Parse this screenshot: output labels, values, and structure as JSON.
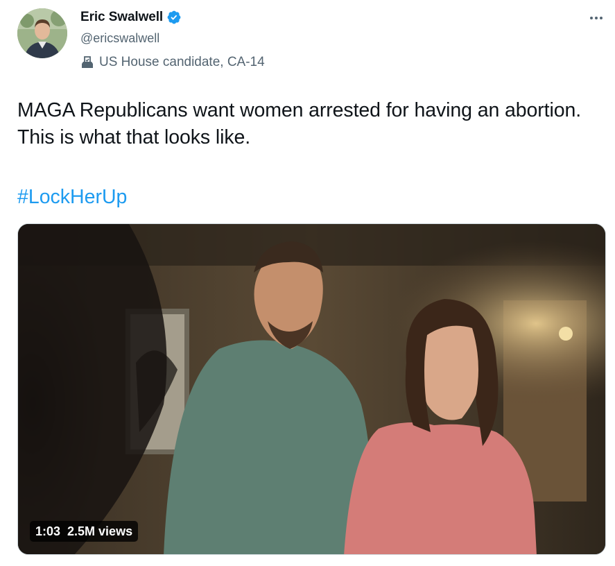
{
  "author": {
    "display_name": "Eric Swalwell",
    "handle": "@ericswalwell",
    "label": "US House candidate, CA-14",
    "avatar_icon": "avatar-photo",
    "verified_icon": "verified-badge-icon",
    "label_icon": "ballot-box-icon"
  },
  "tweet": {
    "text": "MAGA Republicans want women arrested for having an abortion. This is what that looks like.",
    "hashtag": "#LockHerUp"
  },
  "media": {
    "duration": "1:03",
    "views": "2.5M views"
  },
  "colors": {
    "link": "#1d9bf0",
    "secondary_text": "#536471",
    "verified": "#1d9bf0"
  }
}
